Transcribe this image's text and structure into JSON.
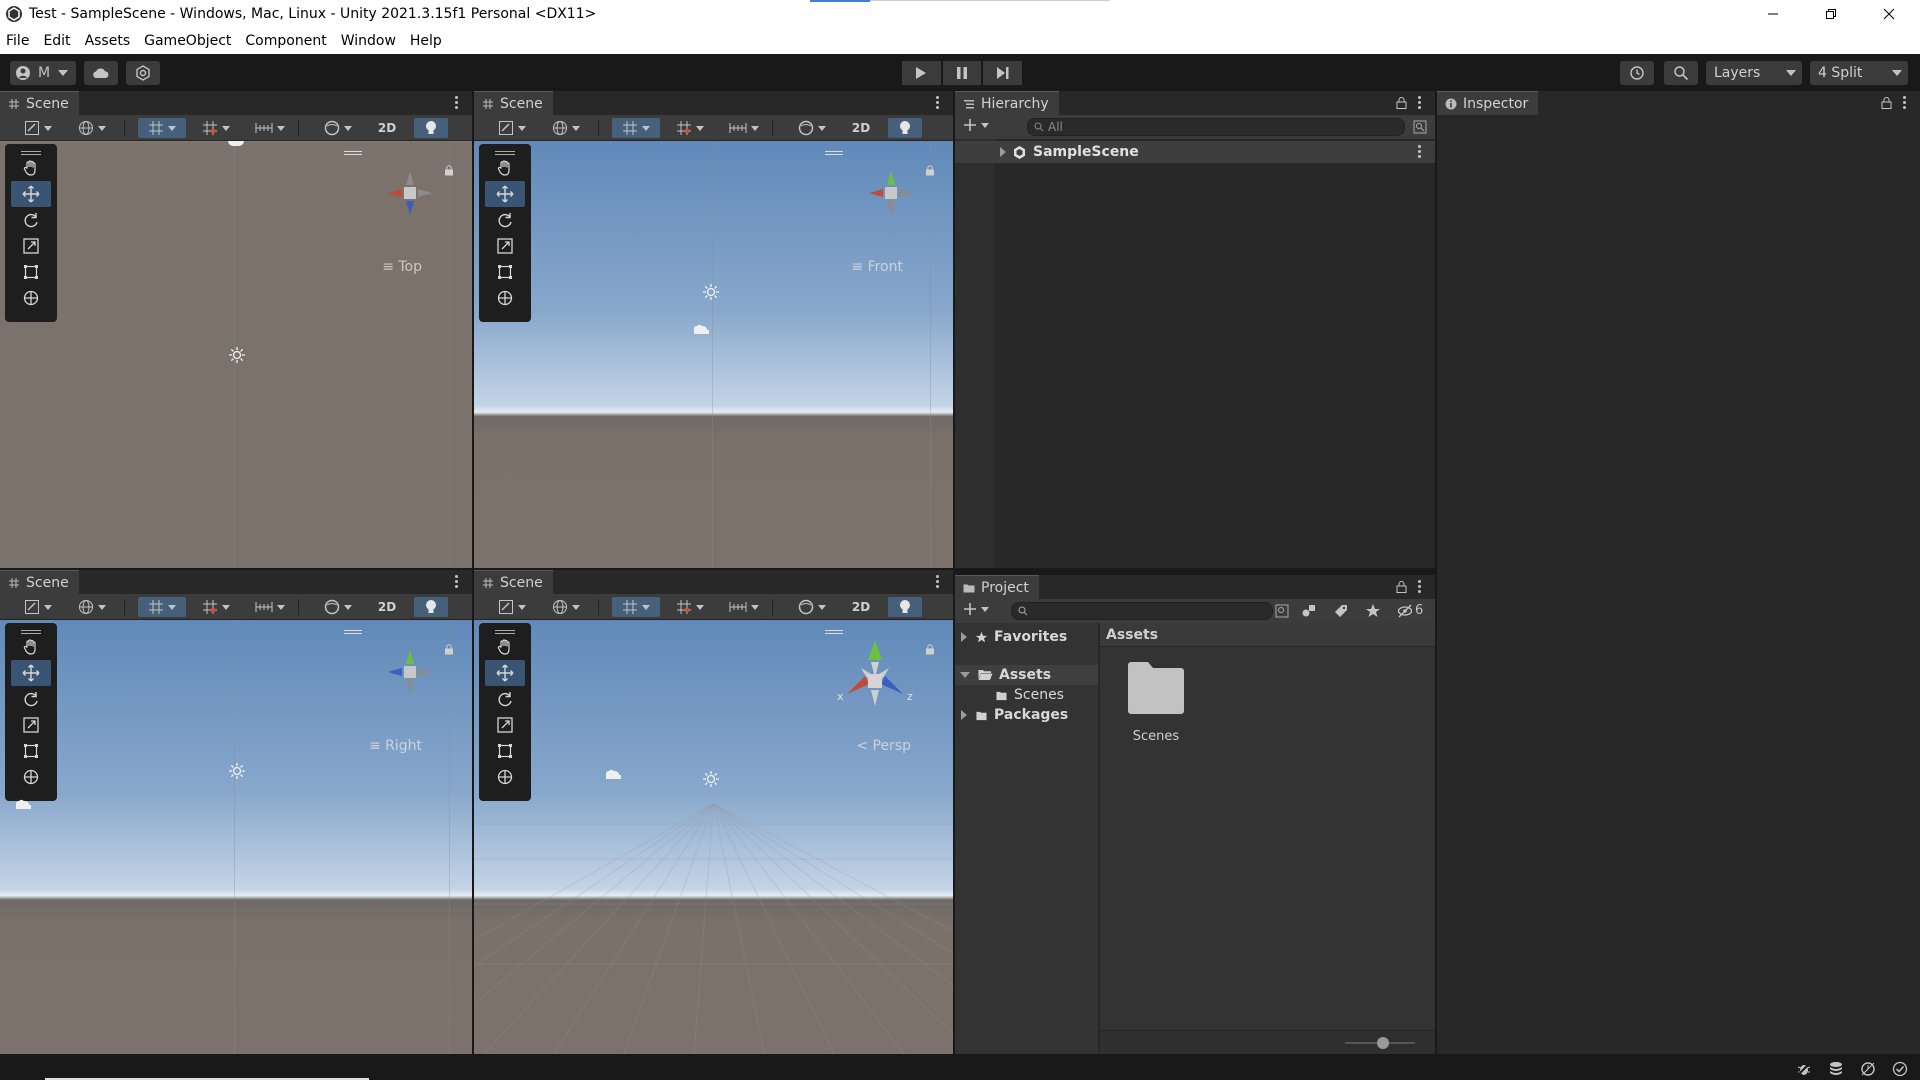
{
  "window": {
    "title": "Test - SampleScene - Windows, Mac, Linux - Unity 2021.3.15f1 Personal <DX11>"
  },
  "menu": [
    "File",
    "Edit",
    "Assets",
    "GameObject",
    "Component",
    "Window",
    "Help"
  ],
  "toolbar": {
    "account": "M",
    "layers": "Layers",
    "layout": "4 Split"
  },
  "scenes": [
    {
      "tab": "Scene",
      "view": "Top",
      "type": "top"
    },
    {
      "tab": "Scene",
      "view": "Front",
      "type": "front"
    },
    {
      "tab": "Scene",
      "view": "Right",
      "type": "right"
    },
    {
      "tab": "Scene",
      "view": "Persp",
      "type": "persp"
    }
  ],
  "scene_toolbar": {
    "btn_2d": "2D"
  },
  "hierarchy": {
    "tab": "Hierarchy",
    "search_placeholder": "All",
    "root": "SampleScene"
  },
  "inspector": {
    "tab": "Inspector"
  },
  "project": {
    "tab": "Project",
    "tree": {
      "favorites": "Favorites",
      "assets": "Assets",
      "scenes": "Scenes",
      "packages": "Packages"
    },
    "breadcrumb": "Assets",
    "items": [
      {
        "name": "Scenes"
      }
    ],
    "hidden_count": "6"
  },
  "gizmo_axes": {
    "x": "x",
    "z": "z"
  }
}
